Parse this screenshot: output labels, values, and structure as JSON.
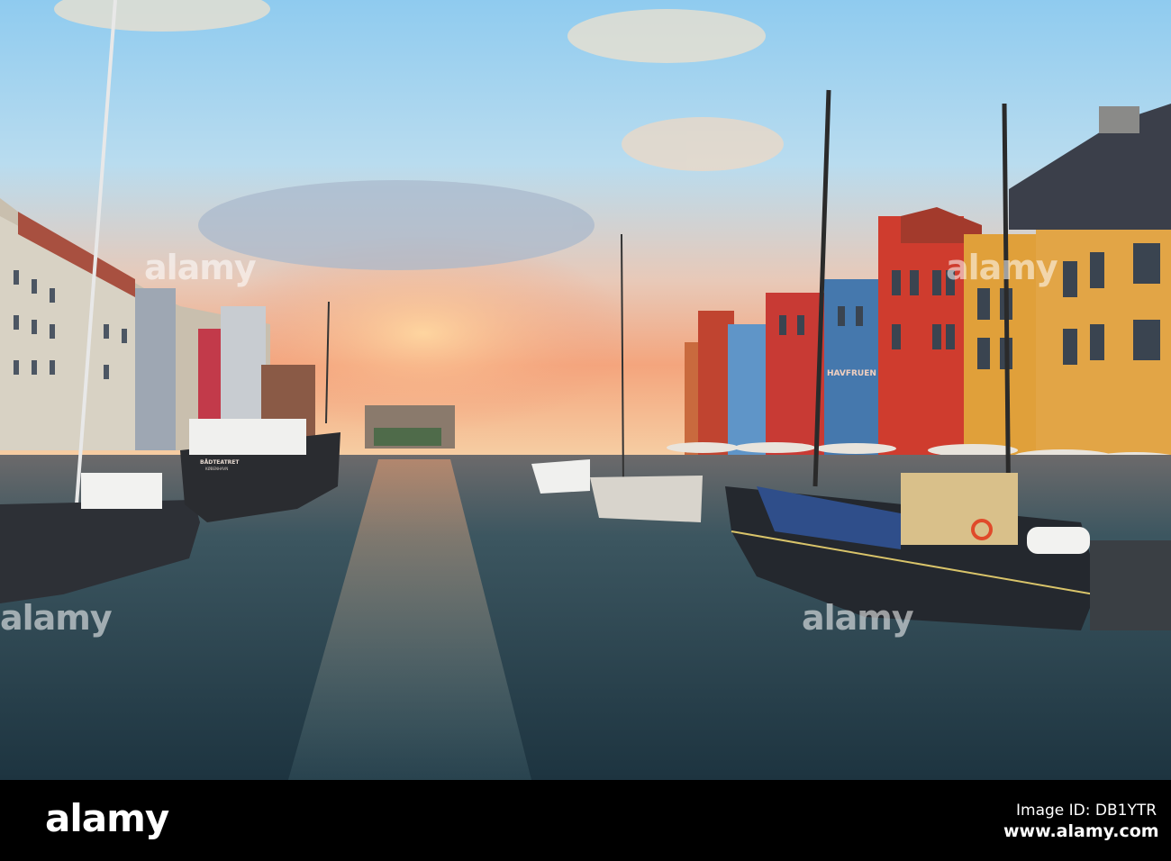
{
  "watermark": {
    "text": "alamy"
  },
  "footer": {
    "logo_text": "alamy",
    "image_id": "Image ID: DB1YTR",
    "url": "www.alamy.com"
  },
  "scene": {
    "boat_name": "BÅDTEATRET",
    "boat_city": "KØBENHAVN",
    "restaurant_sign": "HAVFRUEN"
  },
  "colors": {
    "sky_top": "#9fd0ee",
    "sunset": "#f2a07a",
    "water": "#2d4a55",
    "bar": "#000000"
  }
}
